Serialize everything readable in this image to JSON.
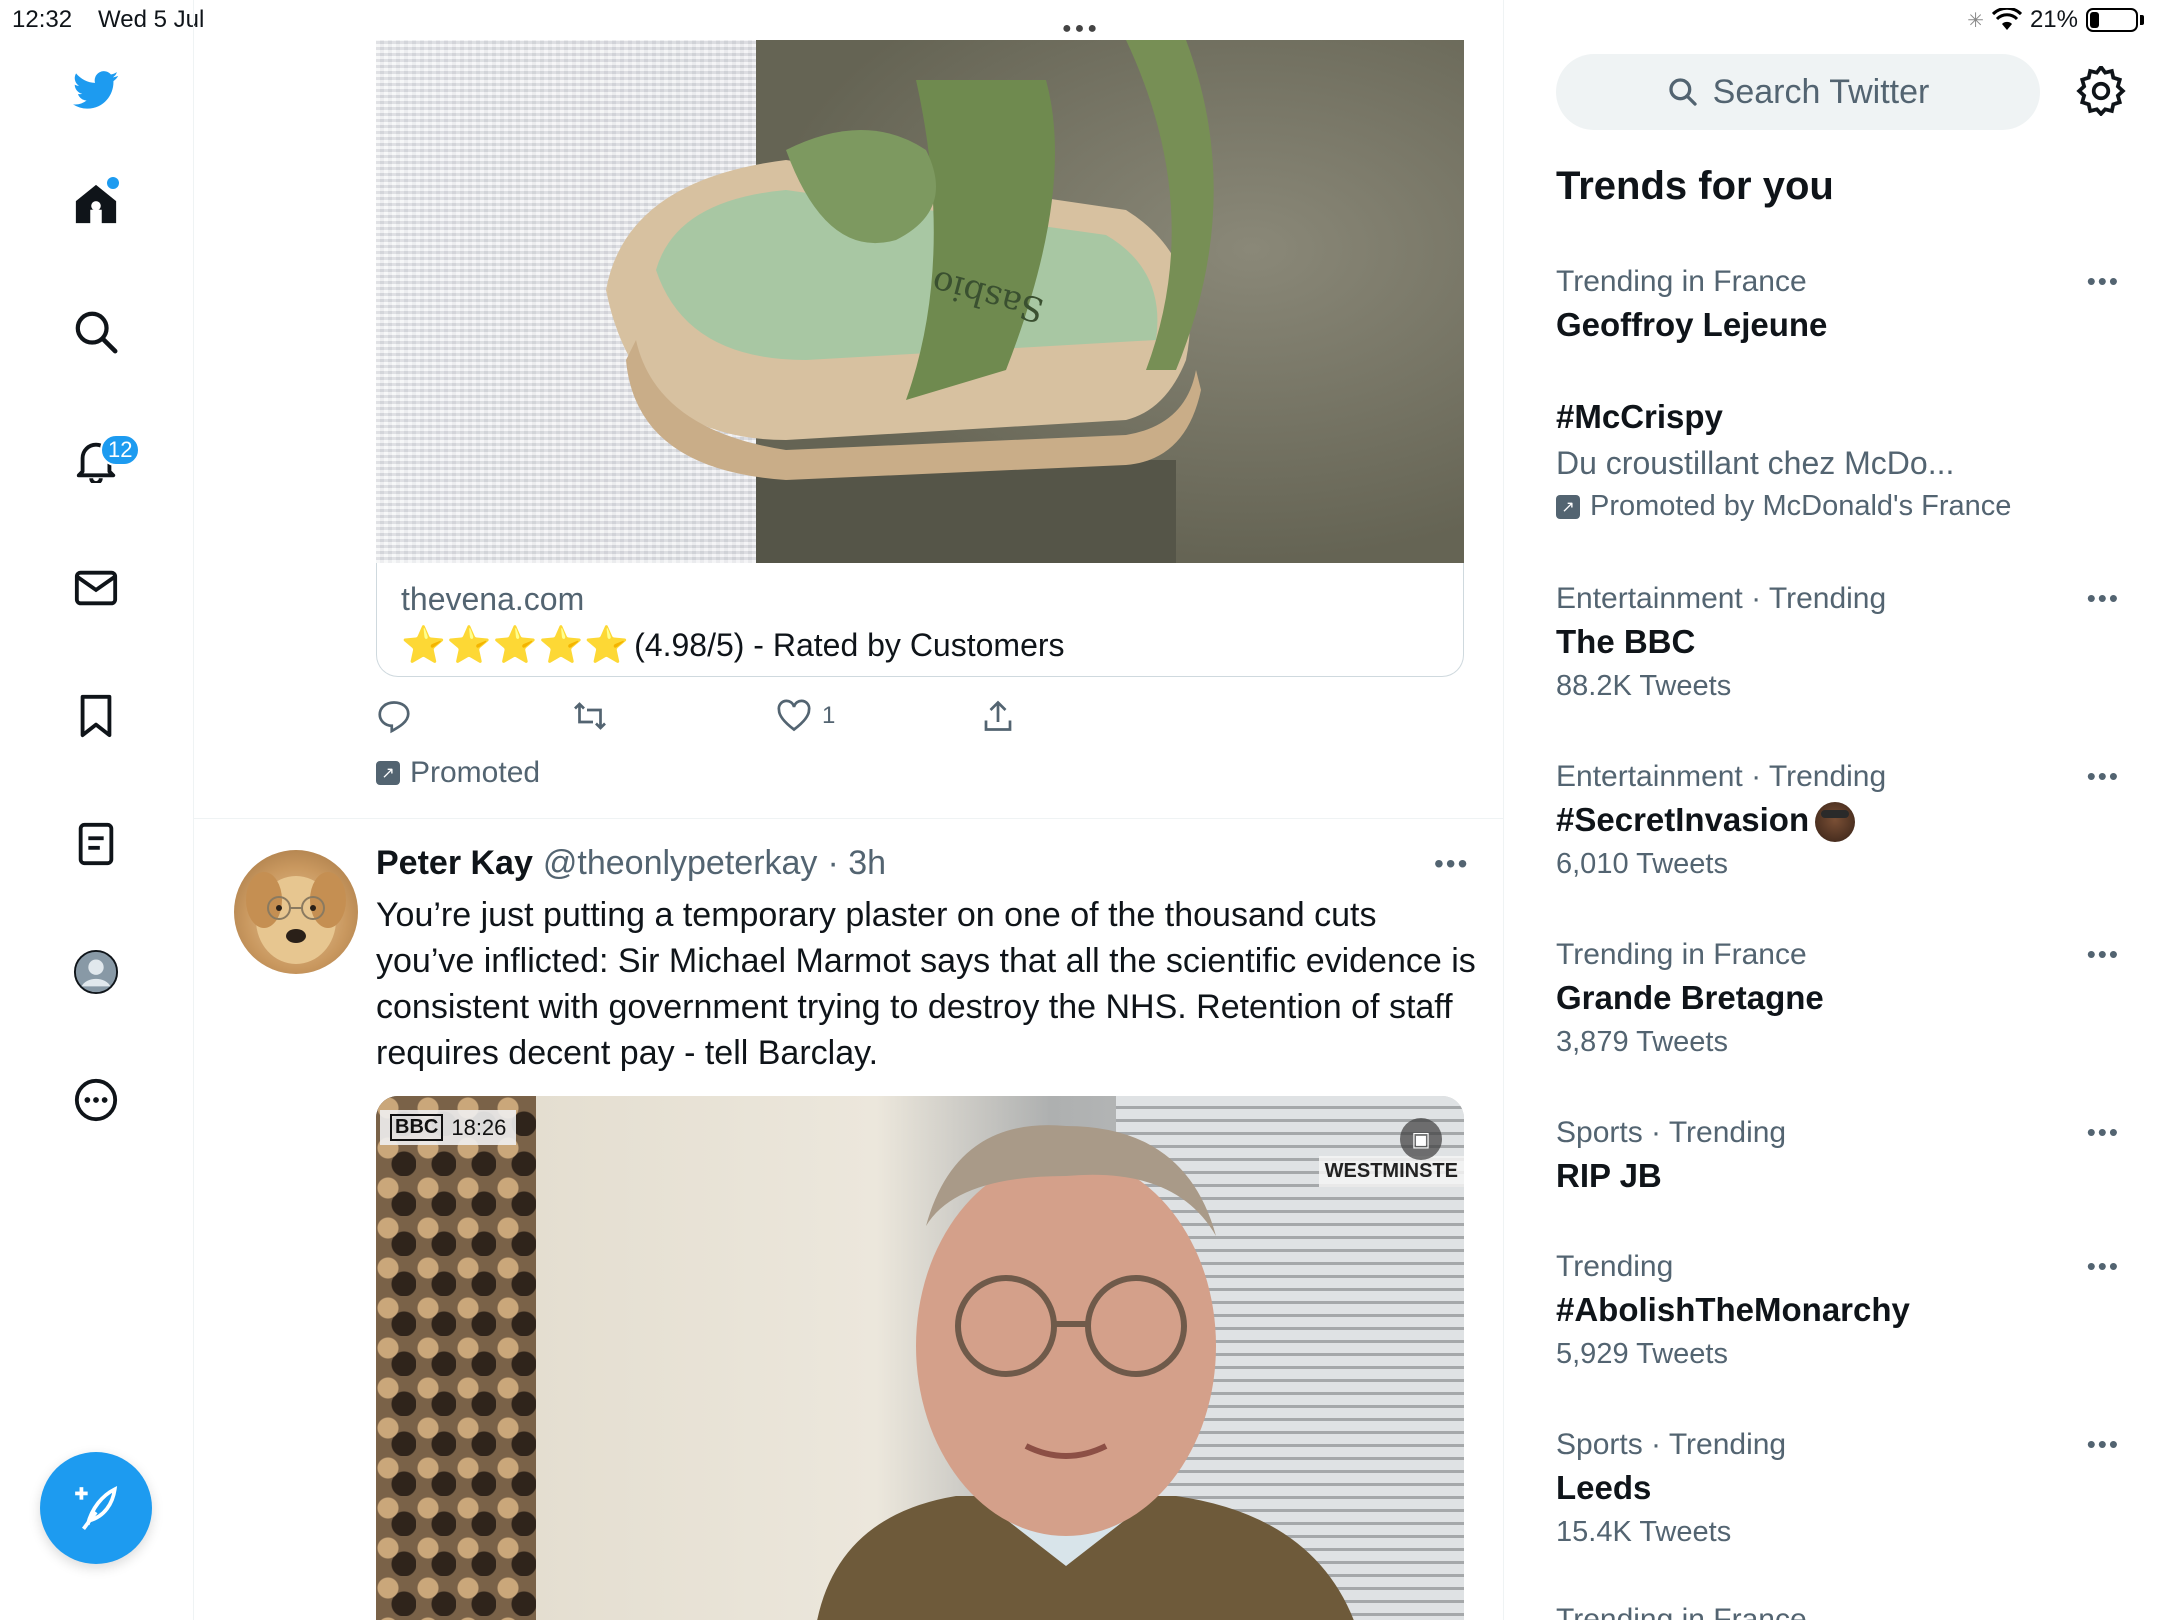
{
  "status_bar": {
    "time": "12:32",
    "date": "Wed 5 Jul",
    "battery": "21%",
    "battery_level": 0.21
  },
  "nav": {
    "notifications_count": "12",
    "items": [
      "twitter-logo",
      "home-icon",
      "search-icon",
      "bell-icon",
      "mail-icon",
      "bookmark-icon",
      "lists-icon",
      "profile-icon",
      "more-icon"
    ]
  },
  "ad": {
    "domain": "thevena.com",
    "stars": "⭐⭐⭐⭐⭐",
    "rating_text": "(4.98/5) - Rated by Customers",
    "like_count": "1",
    "promoted_label": "Promoted"
  },
  "tweet": {
    "name": "Peter Kay",
    "handle": "@theonlypeterkay",
    "time": "· 3h",
    "text": "You’re just putting a temporary plaster on one of the thousand cuts you’ve inflicted: Sir Michael Marmot says that all the scientific evidence is consistent with government trying to destroy the NHS. Retention of staff requires decent pay - tell Barclay.",
    "media": {
      "channel": "BBC",
      "clock": "18:26",
      "location": "WESTMINSTE"
    }
  },
  "search": {
    "placeholder": "Search Twitter"
  },
  "trends": {
    "title": "Trends for you",
    "items": [
      {
        "context": "Trending in France",
        "name": "Geoffroy Lejeune"
      },
      {
        "name": "#McCrispy",
        "description": "Du croustillant chez McDo...",
        "promoted_by": "Promoted by McDonald's France"
      },
      {
        "context": "Entertainment · Trending",
        "name": "The BBC",
        "count": "88.2K Tweets"
      },
      {
        "context": "Entertainment · Trending",
        "name": "#SecretInvasion",
        "count": "6,010 Tweets"
      },
      {
        "context": "Trending in France",
        "name": "Grande Bretagne",
        "count": "3,879 Tweets"
      },
      {
        "context": "Sports · Trending",
        "name": "RIP JB"
      },
      {
        "context": "Trending",
        "name": "#AbolishTheMonarchy",
        "count": "5,929 Tweets"
      },
      {
        "context": "Sports · Trending",
        "name": "Leeds",
        "count": "15.4K Tweets"
      },
      {
        "context": "Trending in France"
      }
    ]
  },
  "colors": {
    "accent": "#1d9bf0",
    "secondary_text": "#536471",
    "primary_text": "#0f1419"
  }
}
